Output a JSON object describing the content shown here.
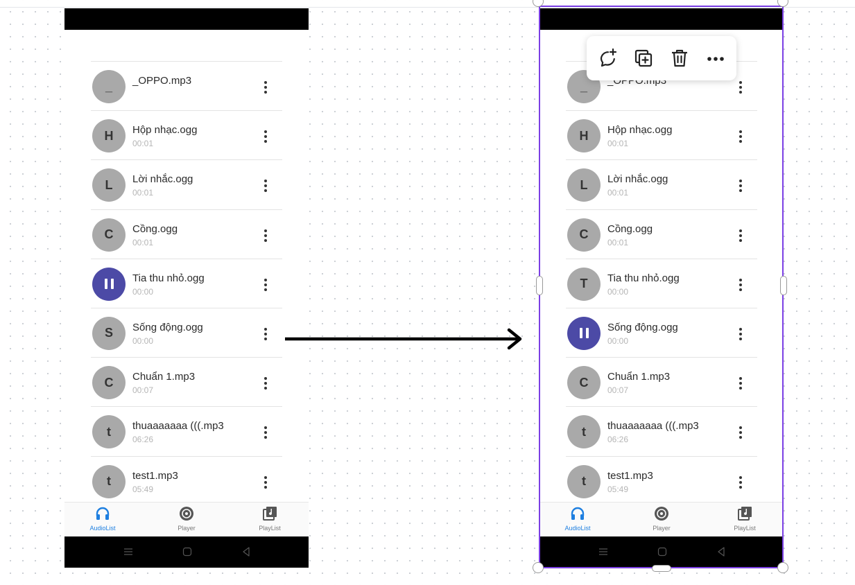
{
  "left_phone": {
    "tracks": [
      {
        "letter": "_",
        "title": "_OPPO.mp3",
        "duration": "",
        "playing": false
      },
      {
        "letter": "H",
        "title": "Hộp nhạc.ogg",
        "duration": "00:01",
        "playing": false
      },
      {
        "letter": "L",
        "title": "Lời nhắc.ogg",
        "duration": "00:01",
        "playing": false
      },
      {
        "letter": "C",
        "title": "Cồng.ogg",
        "duration": "00:01",
        "playing": false
      },
      {
        "letter": "",
        "title": "Tia thu nhỏ.ogg",
        "duration": "00:00",
        "playing": true
      },
      {
        "letter": "S",
        "title": "Sống động.ogg",
        "duration": "00:00",
        "playing": false
      },
      {
        "letter": "C",
        "title": "Chuẩn 1.mp3",
        "duration": "00:07",
        "playing": false
      },
      {
        "letter": "t",
        "title": "thuaaaaaaa (((.mp3",
        "duration": "06:26",
        "playing": false
      },
      {
        "letter": "t",
        "title": "test1.mp3",
        "duration": "05:49",
        "playing": false
      }
    ]
  },
  "right_phone": {
    "tracks": [
      {
        "letter": "_",
        "title": "_OPPO.mp3",
        "duration": "",
        "playing": false
      },
      {
        "letter": "H",
        "title": "Hộp nhạc.ogg",
        "duration": "00:01",
        "playing": false
      },
      {
        "letter": "L",
        "title": "Lời nhắc.ogg",
        "duration": "00:01",
        "playing": false
      },
      {
        "letter": "C",
        "title": "Cồng.ogg",
        "duration": "00:01",
        "playing": false
      },
      {
        "letter": "T",
        "title": "Tia thu nhỏ.ogg",
        "duration": "00:00",
        "playing": false
      },
      {
        "letter": "",
        "title": "Sống động.ogg",
        "duration": "00:00",
        "playing": true
      },
      {
        "letter": "C",
        "title": "Chuẩn 1.mp3",
        "duration": "00:07",
        "playing": false
      },
      {
        "letter": "t",
        "title": "thuaaaaaaa (((.mp3",
        "duration": "06:26",
        "playing": false
      },
      {
        "letter": "t",
        "title": "test1.mp3",
        "duration": "05:49",
        "playing": false
      }
    ]
  },
  "bottom_nav": {
    "audiolist_label": "AudioList",
    "player_label": "Player",
    "playlist_label": "PlayList"
  },
  "toolbar": {
    "icons": [
      "add-comment-icon",
      "duplicate-icon",
      "trash-icon",
      "more-icon"
    ]
  },
  "colors": {
    "accent": "#4c4aa6",
    "active_nav": "#1e7fe0",
    "selection": "#7b3fe4",
    "avatar": "#a9a9a9"
  }
}
